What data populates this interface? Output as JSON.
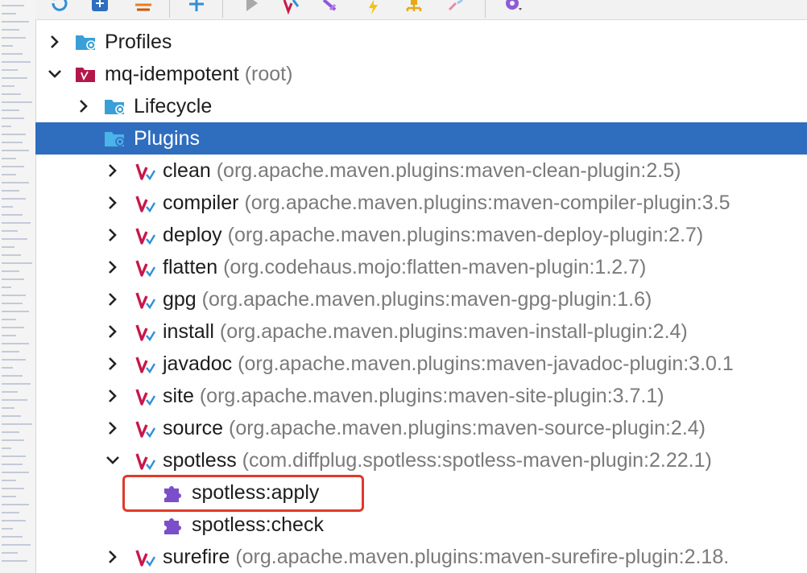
{
  "colors": {
    "selection": "#2f6dbf",
    "highlight_box": "#e0392b",
    "coordinates_text": "#7a7a7a",
    "maven_icon": "#c8174b",
    "goal_icon": "#7b4fc9",
    "folder_icon": "#3a9fd6"
  },
  "toolbar": {
    "icons": [
      "reload-icon",
      "generate-sources-icon",
      "download-icon",
      "add-icon",
      "run-icon",
      "maven-run-icon",
      "toggle-offline-icon",
      "lightning-icon",
      "dependency-diagram-icon",
      "collapse-icon",
      "settings-icon"
    ]
  },
  "tree": {
    "profiles": {
      "label": "Profiles",
      "icon": "folder-gear-icon",
      "expanded": false
    },
    "root": {
      "label": "mq-idempotent",
      "suffix": "(root)",
      "icon": "maven-project-icon",
      "expanded": true
    },
    "lifecycle": {
      "label": "Lifecycle",
      "icon": "folder-gear-icon",
      "expanded": false
    },
    "plugins": {
      "label": "Plugins",
      "icon": "folder-gear-icon",
      "expanded": true,
      "selected": true
    },
    "plugin_items": [
      {
        "name": "clean",
        "coords": "(org.apache.maven.plugins:maven-clean-plugin:2.5)"
      },
      {
        "name": "compiler",
        "coords": "(org.apache.maven.plugins:maven-compiler-plugin:3.5"
      },
      {
        "name": "deploy",
        "coords": "(org.apache.maven.plugins:maven-deploy-plugin:2.7)"
      },
      {
        "name": "flatten",
        "coords": "(org.codehaus.mojo:flatten-maven-plugin:1.2.7)"
      },
      {
        "name": "gpg",
        "coords": "(org.apache.maven.plugins:maven-gpg-plugin:1.6)"
      },
      {
        "name": "install",
        "coords": "(org.apache.maven.plugins:maven-install-plugin:2.4)"
      },
      {
        "name": "javadoc",
        "coords": "(org.apache.maven.plugins:maven-javadoc-plugin:3.0.1"
      },
      {
        "name": "site",
        "coords": "(org.apache.maven.plugins:maven-site-plugin:3.7.1)"
      },
      {
        "name": "source",
        "coords": "(org.apache.maven.plugins:maven-source-plugin:2.4)"
      },
      {
        "name": "spotless",
        "coords": "(com.diffplug.spotless:spotless-maven-plugin:2.22.1)",
        "expanded": true
      },
      {
        "name": "surefire",
        "coords": "(org.apache.maven.plugins:maven-surefire-plugin:2.18."
      }
    ],
    "spotless_goals": [
      {
        "label": "spotless:apply",
        "highlighted": true
      },
      {
        "label": "spotless:check",
        "highlighted": false
      }
    ]
  }
}
